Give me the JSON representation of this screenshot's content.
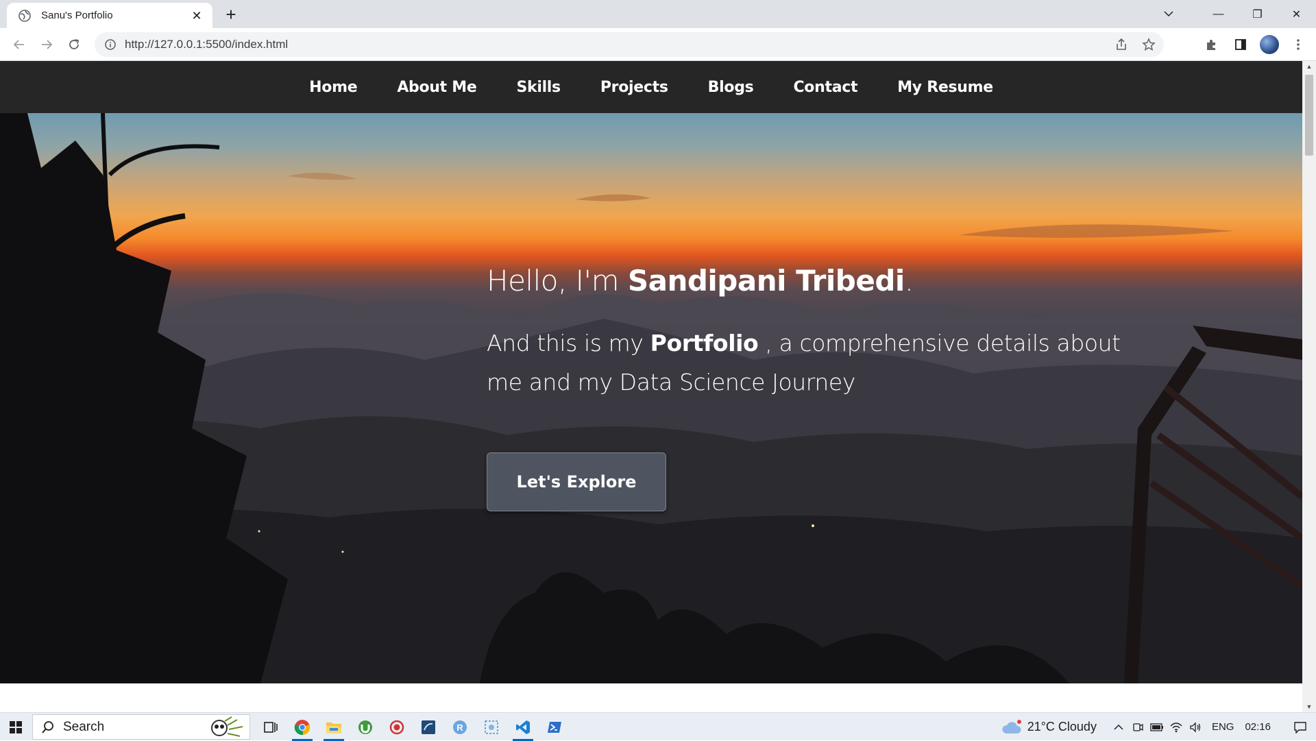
{
  "browser": {
    "tab_title": "Sanu's Portfolio",
    "tab_close": "✕",
    "new_tab": "+",
    "url": "http://127.0.0.1:5500/index.html",
    "window_controls": {
      "minimize": "—",
      "restore": "❐",
      "close": "✕"
    }
  },
  "site": {
    "nav": [
      "Home",
      "About Me",
      "Skills",
      "Projects",
      "Blogs",
      "Contact",
      "My Resume"
    ],
    "hero": {
      "greeting_prefix": "Hello, I'm ",
      "name": "Sandipani Tribedi",
      "greeting_suffix": ".",
      "tagline_prefix": "And this is my ",
      "tagline_bold": "Portfolio",
      "tagline_suffix": " , a comprehensive details about me and my Data Science Journey",
      "cta": "Let's Explore"
    }
  },
  "taskbar": {
    "search_label": "Search",
    "weather": "21°C  Cloudy",
    "language": "ENG",
    "time": "02:16"
  },
  "colors": {
    "nav_bg": "#262626",
    "button_bg": "#4e5560",
    "accent": "#0067c0"
  }
}
